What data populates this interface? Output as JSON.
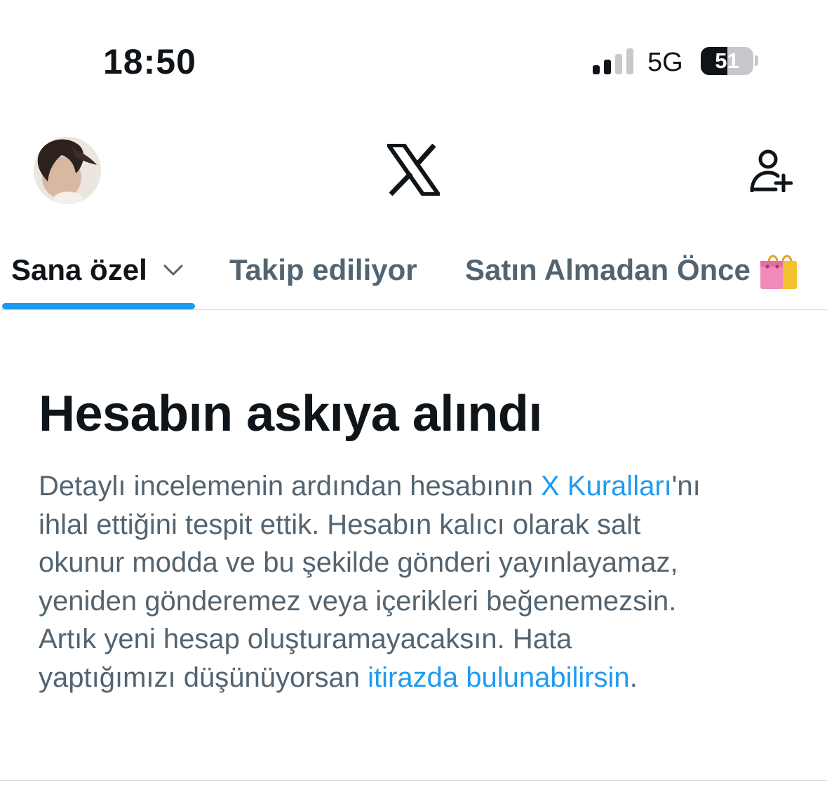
{
  "status_bar": {
    "time": "18:50",
    "network": "5G",
    "battery_percent": "51",
    "battery_level": 0.51,
    "signal_bars_active": 2,
    "signal_bars_total": 4,
    "icons": [
      "cellular-signal-icon",
      "battery-icon"
    ]
  },
  "header": {
    "avatar_icon": "profile-avatar",
    "logo_icon": "x-logo-icon",
    "action_icon": "follow-person-add-icon"
  },
  "tabs": [
    {
      "label": "Sana özel",
      "active": true,
      "icon": "chevron-down-icon"
    },
    {
      "label": "Takip ediliyor",
      "active": false
    },
    {
      "label": "Satın Almadan Önce",
      "active": false,
      "icon": "shopping-bags-emoji"
    }
  ],
  "notice": {
    "title": "Hesabın askıya alındı",
    "body": {
      "line1_pre": "Detaylı incelemenin ardından hesabının ",
      "rules_link": "X Kuralları",
      "line1_post": "'nı",
      "line2": "ihlal ettiğini tespit ettik. Hesabın kalıcı olarak salt",
      "line3": "okunur modda ve bu şekilde gönderi yayınlayamaz,",
      "line4": "yeniden gönderemez veya içerikleri beğenemezsin.",
      "line5": "Artık yeni hesap oluşturamayacaksın. Hata",
      "line6_pre": "yaptığımızı düşünüyorsan ",
      "appeal_link": "itirazda bulunabilirsin",
      "line6_post": "."
    }
  },
  "colors": {
    "accent": "#1d9bf0",
    "text_primary": "#0f1419",
    "text_secondary": "#536471",
    "divider": "#d9dde0"
  }
}
